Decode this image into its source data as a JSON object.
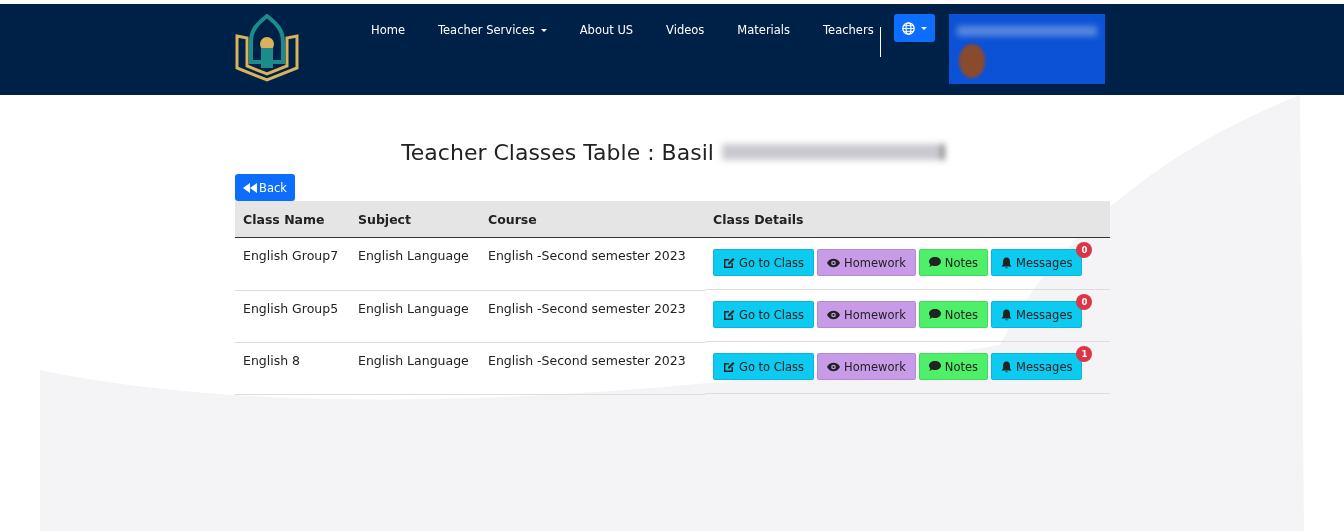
{
  "nav": {
    "items": [
      {
        "label": "Home",
        "dropdown": false
      },
      {
        "label": "Teacher Services",
        "dropdown": true
      },
      {
        "label": "About US",
        "dropdown": false
      },
      {
        "label": "Videos",
        "dropdown": false
      },
      {
        "label": "Materials",
        "dropdown": false
      },
      {
        "label": "Teachers",
        "dropdown": false
      }
    ]
  },
  "page": {
    "title": "Teacher Classes Table : Basil",
    "back": "Back"
  },
  "table": {
    "columns": [
      "Class Name",
      "Subject",
      "Course",
      "Class Details"
    ],
    "rows": [
      {
        "class_name": "English Group7",
        "subject": "English Language",
        "course": "English -Second semester 2023",
        "actions": [
          {
            "kind": "class",
            "label": "Go to Class"
          },
          {
            "kind": "homework",
            "label": "Homework"
          },
          {
            "kind": "notes",
            "label": "Notes"
          },
          {
            "kind": "messages",
            "label": "Messages",
            "count": "0"
          }
        ]
      },
      {
        "class_name": "English Group5",
        "subject": "English Language",
        "course": "English -Second semester 2023",
        "actions": [
          {
            "kind": "class",
            "label": "Go to Class"
          },
          {
            "kind": "homework",
            "label": "Homework"
          },
          {
            "kind": "notes",
            "label": "Notes"
          },
          {
            "kind": "messages",
            "label": "Messages",
            "count": "0"
          }
        ]
      },
      {
        "class_name": "English 8",
        "subject": "English Language",
        "course": "English -Second semester 2023",
        "actions": [
          {
            "kind": "class",
            "label": "Go to Class"
          },
          {
            "kind": "homework",
            "label": "Homework"
          },
          {
            "kind": "notes",
            "label": "Notes"
          },
          {
            "kind": "messages",
            "label": "Messages",
            "count": "1"
          }
        ]
      }
    ]
  }
}
